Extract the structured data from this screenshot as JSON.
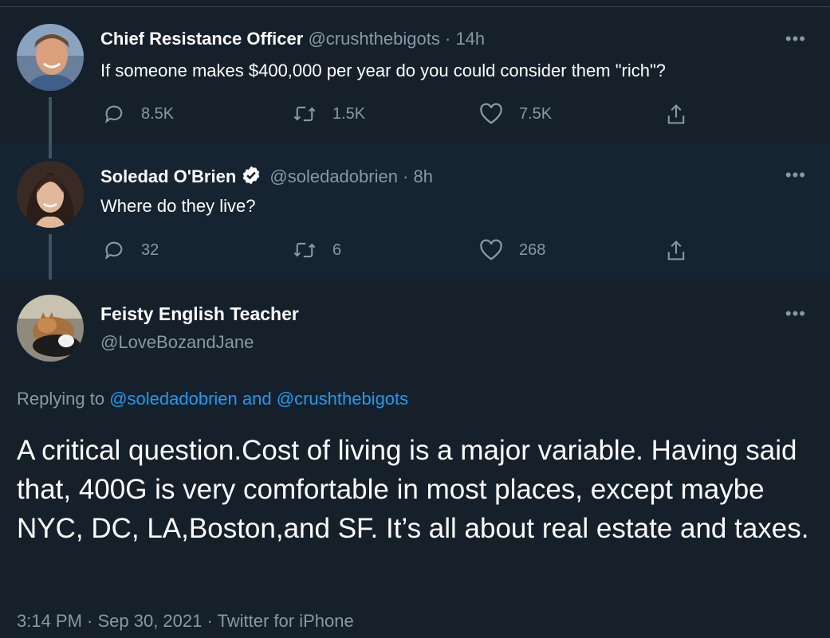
{
  "tweets": [
    {
      "name": "Chief Resistance Officer",
      "handle": "@crushthebigots",
      "time": "14h",
      "text": "If someone makes $400,000 per year do you could consider them \"rich\"?",
      "replies": "8.5K",
      "retweets": "1.5K",
      "likes": "7.5K",
      "more": "•••"
    },
    {
      "name": "Soledad O'Brien",
      "handle": "@soledadobrien",
      "time": "8h",
      "text": "Where do they live?",
      "replies": "32",
      "retweets": "6",
      "likes": "268",
      "more": "•••"
    }
  ],
  "separator": "·",
  "main": {
    "name": "Feisty English Teacher",
    "handle": "@LoveBozandJane",
    "more": "•••",
    "replying_prefix": "Replying to",
    "mention1": "@soledadobrien",
    "replying_and": "and",
    "mention2": "@crushthebigots",
    "text": "A critical question.Cost of living is a major variable. Having said that, 400G is very comfortable in most places, except maybe NYC, DC, LA,Boston,and SF. It’s all about real estate and taxes.",
    "meta": "3:14 PM · Sep 30, 2021 · Twitter for iPhone"
  },
  "colors": {
    "background": "#15202b",
    "text": "#ffffff",
    "secondary": "#8899a6",
    "link": "#1d9bf0",
    "verified": "#ffffff"
  },
  "icons": [
    "reply-icon",
    "retweet-icon",
    "like-icon",
    "share-icon",
    "verified-badge-icon",
    "more-icon"
  ]
}
